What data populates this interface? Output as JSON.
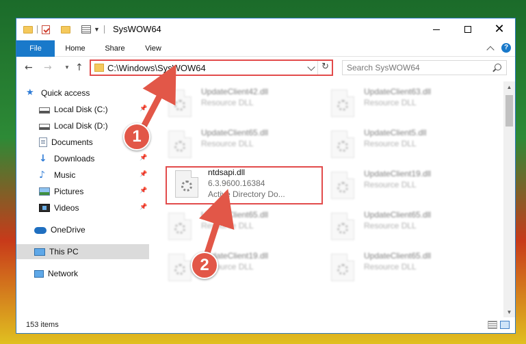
{
  "window": {
    "title": "SysWOW64"
  },
  "ribbon": {
    "tabs": [
      {
        "label": "File"
      },
      {
        "label": "Home"
      },
      {
        "label": "Share"
      },
      {
        "label": "View"
      }
    ],
    "help_glyph": "?"
  },
  "address": {
    "path": "C:\\Windows\\SysWOW64",
    "search_placeholder": "Search SysWOW64"
  },
  "nav": {
    "items": [
      {
        "label": "Quick access",
        "icon": "star-icon"
      },
      {
        "label": "Local Disk (C:)",
        "icon": "drive-icon",
        "pinned": true
      },
      {
        "label": "Local Disk (D:)",
        "icon": "drive-icon"
      },
      {
        "label": "Documents",
        "icon": "documents-icon",
        "pinned": true
      },
      {
        "label": "Downloads",
        "icon": "download-icon",
        "pinned": true
      },
      {
        "label": "Music",
        "icon": "music-icon",
        "pinned": true
      },
      {
        "label": "Pictures",
        "icon": "pictures-icon",
        "pinned": true
      },
      {
        "label": "Videos",
        "icon": "videos-icon",
        "pinned": true
      },
      {
        "label": "OneDrive",
        "icon": "onedrive-icon"
      },
      {
        "label": "This PC",
        "icon": "pc-icon",
        "selected": true
      },
      {
        "label": "Network",
        "icon": "network-icon"
      }
    ]
  },
  "files": {
    "focused": {
      "name": "ntdsapi.dll",
      "version": "6.3.9600.16384",
      "description": "Active Directory Do..."
    },
    "blurred": [
      {
        "name": "UpdateClient42.dll",
        "type": "Resource DLL"
      },
      {
        "name": "UpdateClient63.dll",
        "type": "Resource DLL"
      },
      {
        "name": "UpdateClient65.dll",
        "type": "Resource DLL"
      },
      {
        "name": "UpdateClient5.dll",
        "type": "Resource DLL"
      },
      {
        "name": "UpdateClient19.dll",
        "type": "Resource DLL"
      },
      {
        "name": "UpdateClient65.dll",
        "type": "Resource DLL"
      },
      {
        "name": "UpdateClient65.dll",
        "type": "Resource DLL"
      },
      {
        "name": "UpdateClient19.dll",
        "type": "Resource DLL"
      },
      {
        "name": "UpdateClient65.dll",
        "type": "Resource DLL"
      }
    ]
  },
  "status": {
    "item_count": "153 items"
  },
  "annotations": {
    "step1": "1",
    "step2": "2",
    "color": "#e25748"
  }
}
